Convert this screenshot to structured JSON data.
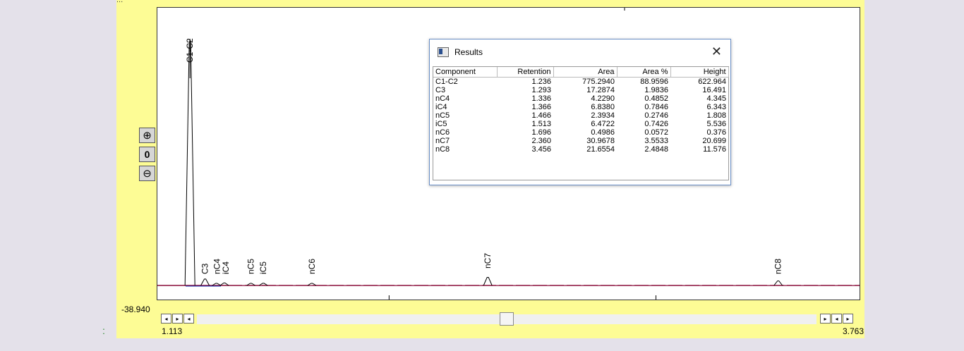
{
  "plot": {
    "top_text": "...",
    "ymin_label": "-38.940",
    "xmin_label": "1.113",
    "xmax_label": "3.763",
    "colon": ":",
    "colors": {
      "panel": "#fdfc95",
      "trace": "#000000",
      "baseline": "#8a0f3a",
      "blue": "#1f3fbf"
    }
  },
  "zoom": {
    "in_icon": "⊕",
    "reset_icon": "0",
    "out_icon": "⊖"
  },
  "scroll": {
    "left": "◂",
    "right": "▸"
  },
  "results": {
    "title": "Results",
    "close": "✕",
    "columns": [
      "Component",
      "Retention",
      "Area",
      "Area %",
      "Height"
    ],
    "rows": [
      [
        "C1-C2",
        "1.236",
        "775.2940",
        "88.9596",
        "622.964"
      ],
      [
        "C3",
        "1.293",
        "17.2874",
        "1.9836",
        "16.491"
      ],
      [
        "nC4",
        "1.336",
        "4.2290",
        "0.4852",
        "4.345"
      ],
      [
        "iC4",
        "1.366",
        "6.8380",
        "0.7846",
        "6.343"
      ],
      [
        "nC5",
        "1.466",
        "2.3934",
        "0.2746",
        "1.808"
      ],
      [
        "iC5",
        "1.513",
        "6.4722",
        "0.7426",
        "5.536"
      ],
      [
        "nC6",
        "1.696",
        "0.4986",
        "0.0572",
        "0.376"
      ],
      [
        "nC7",
        "2.360",
        "30.9678",
        "3.5533",
        "20.699"
      ],
      [
        "nC8",
        "3.456",
        "21.6554",
        "2.4848",
        "11.576"
      ]
    ]
  },
  "chart_data": {
    "type": "line",
    "xlim": [
      1.113,
      3.763
    ],
    "ylim_min": -38.94,
    "peak_labels": [
      "C1-C2",
      "C3",
      "nC4",
      "iC4",
      "nC5",
      "iC5",
      "nC6",
      "nC7",
      "nC8"
    ],
    "peaks": [
      {
        "name": "C1-C2",
        "x": 1.236,
        "height": 622.964
      },
      {
        "name": "C3",
        "x": 1.293,
        "height": 16.491
      },
      {
        "name": "nC4",
        "x": 1.336,
        "height": 4.345
      },
      {
        "name": "iC4",
        "x": 1.366,
        "height": 6.343
      },
      {
        "name": "nC5",
        "x": 1.466,
        "height": 1.808
      },
      {
        "name": "iC5",
        "x": 1.513,
        "height": 5.536
      },
      {
        "name": "nC6",
        "x": 1.696,
        "height": 0.376
      },
      {
        "name": "nC7",
        "x": 2.36,
        "height": 20.699
      },
      {
        "name": "nC8",
        "x": 3.456,
        "height": 11.576
      }
    ],
    "grid": false
  }
}
